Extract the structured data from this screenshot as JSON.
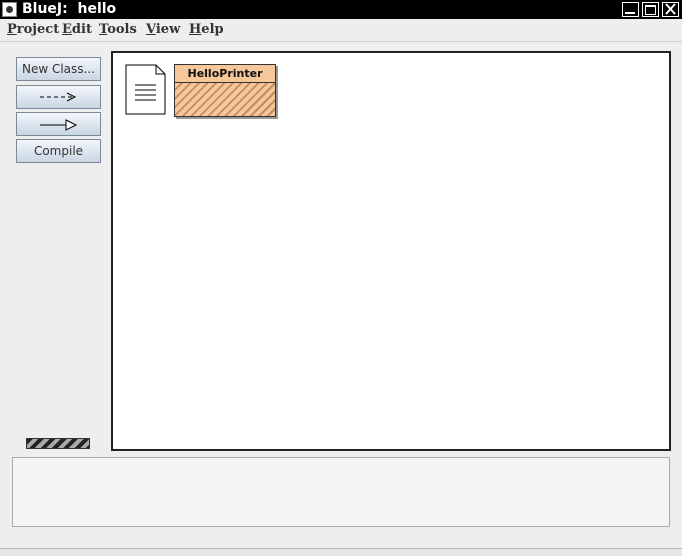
{
  "window": {
    "title": "BlueJ:  hello",
    "icons": [
      "bluej-app-icon",
      "minimize-icon",
      "maximize-icon",
      "close-icon"
    ]
  },
  "menubar": {
    "items": [
      {
        "mnemonic": "P",
        "rest": "roject"
      },
      {
        "mnemonic": "E",
        "rest": "dit"
      },
      {
        "mnemonic": "T",
        "rest": "ools"
      },
      {
        "mnemonic": "V",
        "rest": "iew"
      },
      {
        "mnemonic": "H",
        "rest": "elp"
      }
    ]
  },
  "toolbar": {
    "new_class_label": "New Class...",
    "uses_arrow_icon": "dashed-arrow-icon",
    "inherits_arrow_icon": "inheritance-arrow-icon",
    "compile_label": "Compile"
  },
  "diagram": {
    "readme_icon": "document-icon",
    "classes": [
      {
        "name": "HelloPrinter",
        "needs_compile": true,
        "color": "#f5c79a"
      }
    ]
  },
  "colors": {
    "title_bg": "#000000",
    "button_gradient_top": "#f3f6fa",
    "button_gradient_bottom": "#c9d6e3",
    "class_fill": "#f5c79a",
    "class_hatch": "#c38d5d"
  }
}
